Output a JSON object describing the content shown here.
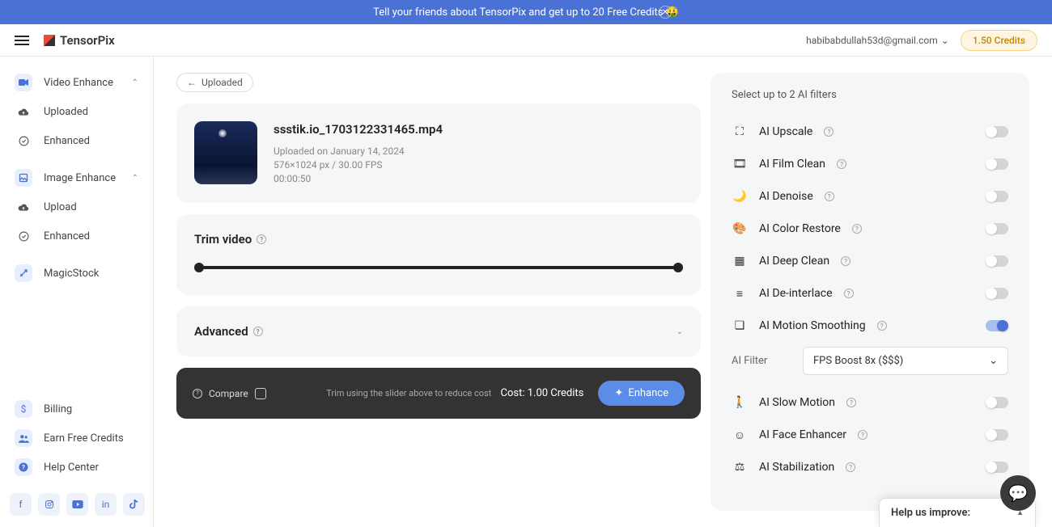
{
  "banner": {
    "text": "Tell your friends about TensorPix and get up to 20 Free Credits 🤑"
  },
  "brand": "TensorPix",
  "user": {
    "email": "habibabdullah53d@gmail.com"
  },
  "credits_badge": "1.50 Credits",
  "sidebar": {
    "video_enhance": "Video Enhance",
    "uploaded": "Uploaded",
    "enhanced": "Enhanced",
    "image_enhance": "Image Enhance",
    "upload": "Upload",
    "enhanced2": "Enhanced",
    "magicstock": "MagicStock",
    "billing": "Billing",
    "earn": "Earn Free Credits",
    "help": "Help Center"
  },
  "back_label": "Uploaded",
  "video": {
    "filename": "ssstik.io_1703122331465.mp4",
    "uploaded_on": "Uploaded on January 14, 2024",
    "dims": "576×1024 px / 30.00 FPS",
    "duration": "00:00:50"
  },
  "trim_title": "Trim video",
  "advanced_title": "Advanced",
  "actionbar": {
    "compare": "Compare",
    "hint": "Trim using the slider above to reduce cost",
    "cost": "Cost: 1.00 Credits",
    "enhance": "Enhance"
  },
  "filters": {
    "title": "Select up to 2 AI filters",
    "upscale": "AI Upscale",
    "film_clean": "AI Film Clean",
    "denoise": "AI Denoise",
    "color_restore": "AI Color Restore",
    "deep_clean": "AI Deep Clean",
    "deinterlace": "AI De-interlace",
    "motion_smoothing": "AI Motion Smoothing",
    "filter_label": "AI Filter",
    "filter_value": "FPS Boost 8x ($$$)",
    "slow_motion": "AI Slow Motion",
    "face_enhancer": "AI Face Enhancer",
    "stabilization": "AI Stabilization"
  },
  "feedback": "Help us improve:"
}
